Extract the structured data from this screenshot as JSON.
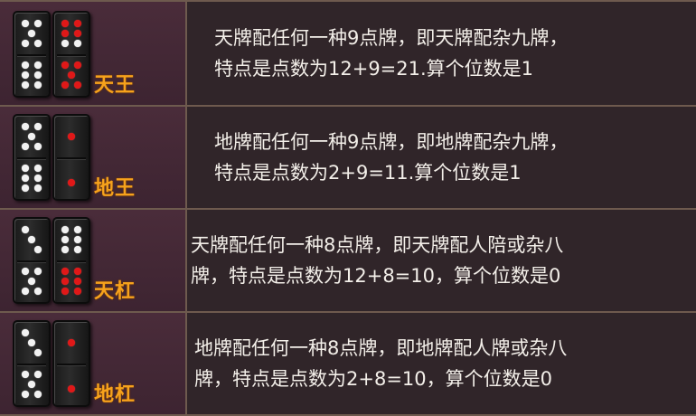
{
  "rows": [
    {
      "name": "天王",
      "text_line1": "天牌配任何一种9点牌，即天牌配杂九牌，",
      "text_line2": "特点是点数为12+9=21.算个位数是1",
      "tile_a": "tian-tile",
      "tile_b": "nine-tile"
    },
    {
      "name": "地王",
      "text_line1": "地牌配任何一种9点牌，即地牌配杂九牌，",
      "text_line2": "特点是点数为2+9=11.算个位数是1",
      "tile_a": "nine-tile",
      "tile_b": "di-tile"
    },
    {
      "name": "天杠",
      "text_line1": "天牌配任何一种8点牌，即天牌配人陪或杂八",
      "text_line2": "牌，特点是点数为12+8=10，算个位数是0",
      "tile_a": "eight-tile",
      "tile_b": "tian-tile"
    },
    {
      "name": "地杠",
      "text_line1": "地牌配任何一种8点牌，即地牌配人牌或杂八",
      "text_line2": "牌，特点是点数为2+8=10，算个位数是0",
      "tile_a": "eight-tile",
      "tile_b": "di-tile"
    }
  ],
  "colors": {
    "name_text": "#f6a21c",
    "body_text": "#f3efe9",
    "pip_white": "#f2f2f2",
    "pip_red": "#e01818"
  }
}
